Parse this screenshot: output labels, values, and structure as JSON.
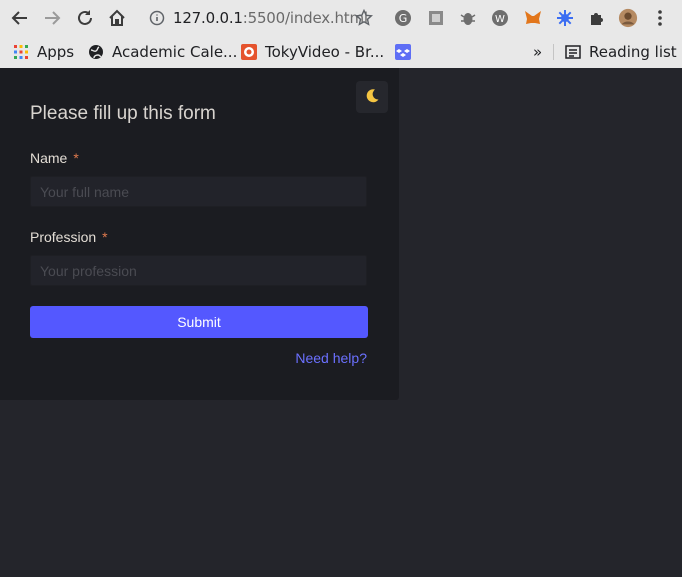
{
  "browser": {
    "url_host": "127.0.0.1",
    "url_rest": ":5500/index.html",
    "bookmarks": [
      {
        "label": "Apps",
        "icon": "apps-grid-icon"
      },
      {
        "label": "Academic Cale...",
        "icon": "globe-icon"
      },
      {
        "label": "TokyVideo - Br...",
        "icon": "tokyvideo-icon"
      },
      {
        "label": "",
        "icon": "dropbox-icon"
      }
    ],
    "more": "»",
    "reading_list": "Reading list"
  },
  "form": {
    "title": "Please fill up this form",
    "theme_toggle_icon": "moon-icon",
    "name_label": "Name",
    "name_required": "*",
    "name_placeholder": "Your full name",
    "profession_label": "Profession",
    "profession_required": "*",
    "profession_placeholder": "Your profession",
    "submit_label": "Submit",
    "help_link": "Need help?"
  },
  "colors": {
    "page_bg": "#24252b",
    "panel_bg": "#1b1c21",
    "accent": "#5458ff",
    "required": "#e07a4e",
    "link": "#6b70ff"
  }
}
